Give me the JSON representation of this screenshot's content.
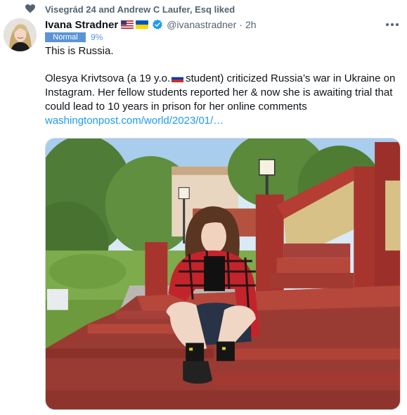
{
  "social_context": {
    "text": "Visegrád 24 and Andrew C Laufer, Esq liked",
    "icon": "heart-icon"
  },
  "author": {
    "name": "Ivana Stradner",
    "handle": "@ivanastradner",
    "separator": "·",
    "time": "2h",
    "flags": [
      "us-flag-icon",
      "ukraine-flag-icon"
    ],
    "verified": true
  },
  "badge": {
    "label": "Normal",
    "percent": "9%"
  },
  "tweet": {
    "line1": "This is Russia.",
    "para_a": "Olesya Krivtsova (a 19 y.o.",
    "para_b": "student) criticized Russia’s war in Ukraine on",
    "line3": "Instagram. Her fellow students reported her & now she is awaiting trial that",
    "line4": "could lead to 10 years in prison for her online comments",
    "link": "washingtonpost.com/world/2023/01/…"
  },
  "colors": {
    "accent": "#1d9bf0",
    "secondary_text": "#536471",
    "badge": "#5b94d6"
  }
}
